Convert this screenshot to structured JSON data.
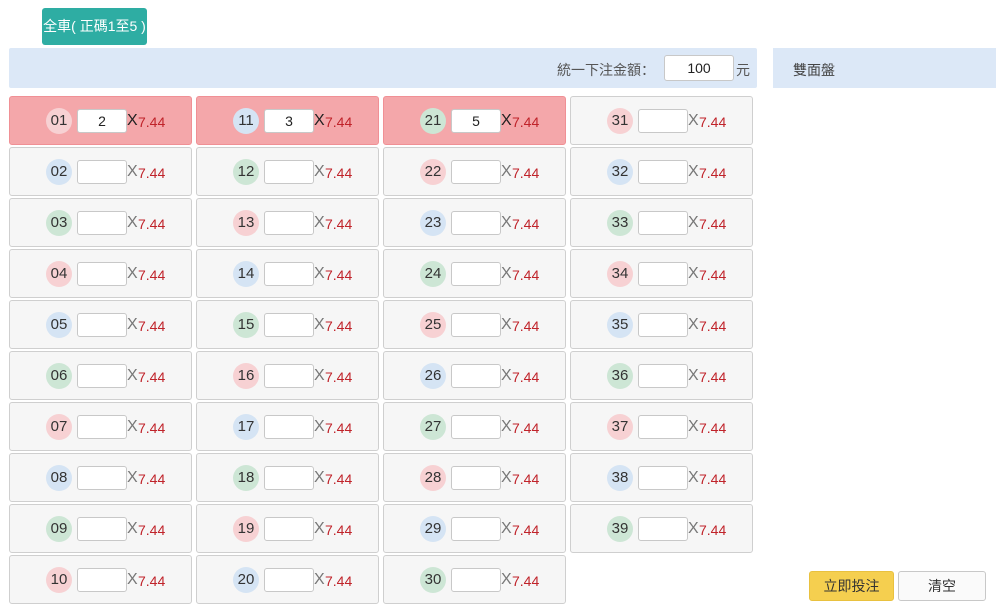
{
  "tab": {
    "label": "全車( 正碼1至5 )"
  },
  "bet_bar": {
    "label": "統一下注金額：",
    "amount": "100",
    "unit": "元"
  },
  "side_panel": {
    "label": "雙面盤"
  },
  "grid": {
    "x_symbol": "X",
    "odds": "7.44",
    "columns": [
      [
        {
          "num": "01",
          "color": "red",
          "amount": "2",
          "selected": true
        },
        {
          "num": "02",
          "color": "blue",
          "amount": "",
          "selected": false
        },
        {
          "num": "03",
          "color": "green",
          "amount": "",
          "selected": false
        },
        {
          "num": "04",
          "color": "red",
          "amount": "",
          "selected": false
        },
        {
          "num": "05",
          "color": "blue",
          "amount": "",
          "selected": false
        },
        {
          "num": "06",
          "color": "green",
          "amount": "",
          "selected": false
        },
        {
          "num": "07",
          "color": "red",
          "amount": "",
          "selected": false
        },
        {
          "num": "08",
          "color": "blue",
          "amount": "",
          "selected": false
        },
        {
          "num": "09",
          "color": "green",
          "amount": "",
          "selected": false
        },
        {
          "num": "10",
          "color": "red",
          "amount": "",
          "selected": false
        }
      ],
      [
        {
          "num": "11",
          "color": "blue",
          "amount": "3",
          "selected": true
        },
        {
          "num": "12",
          "color": "green",
          "amount": "",
          "selected": false
        },
        {
          "num": "13",
          "color": "red",
          "amount": "",
          "selected": false
        },
        {
          "num": "14",
          "color": "blue",
          "amount": "",
          "selected": false
        },
        {
          "num": "15",
          "color": "green",
          "amount": "",
          "selected": false
        },
        {
          "num": "16",
          "color": "red",
          "amount": "",
          "selected": false
        },
        {
          "num": "17",
          "color": "blue",
          "amount": "",
          "selected": false
        },
        {
          "num": "18",
          "color": "green",
          "amount": "",
          "selected": false
        },
        {
          "num": "19",
          "color": "red",
          "amount": "",
          "selected": false
        },
        {
          "num": "20",
          "color": "blue",
          "amount": "",
          "selected": false
        }
      ],
      [
        {
          "num": "21",
          "color": "green",
          "amount": "5",
          "selected": true
        },
        {
          "num": "22",
          "color": "red",
          "amount": "",
          "selected": false
        },
        {
          "num": "23",
          "color": "blue",
          "amount": "",
          "selected": false
        },
        {
          "num": "24",
          "color": "green",
          "amount": "",
          "selected": false
        },
        {
          "num": "25",
          "color": "red",
          "amount": "",
          "selected": false
        },
        {
          "num": "26",
          "color": "blue",
          "amount": "",
          "selected": false
        },
        {
          "num": "27",
          "color": "green",
          "amount": "",
          "selected": false
        },
        {
          "num": "28",
          "color": "red",
          "amount": "",
          "selected": false
        },
        {
          "num": "29",
          "color": "blue",
          "amount": "",
          "selected": false
        },
        {
          "num": "30",
          "color": "green",
          "amount": "",
          "selected": false
        }
      ],
      [
        {
          "num": "31",
          "color": "red",
          "amount": "",
          "selected": false
        },
        {
          "num": "32",
          "color": "blue",
          "amount": "",
          "selected": false
        },
        {
          "num": "33",
          "color": "green",
          "amount": "",
          "selected": false
        },
        {
          "num": "34",
          "color": "red",
          "amount": "",
          "selected": false
        },
        {
          "num": "35",
          "color": "blue",
          "amount": "",
          "selected": false
        },
        {
          "num": "36",
          "color": "green",
          "amount": "",
          "selected": false
        },
        {
          "num": "37",
          "color": "red",
          "amount": "",
          "selected": false
        },
        {
          "num": "38",
          "color": "blue",
          "amount": "",
          "selected": false
        },
        {
          "num": "39",
          "color": "green",
          "amount": "",
          "selected": false
        }
      ]
    ]
  },
  "actions": {
    "submit_label": "立即投注",
    "clear_label": "清空"
  },
  "colors": {
    "tab": "#2eada3",
    "selected": "#f4a7aa",
    "odds": "#c0232a",
    "submit": "#f5cf4f",
    "panel": "#dce8f7"
  }
}
